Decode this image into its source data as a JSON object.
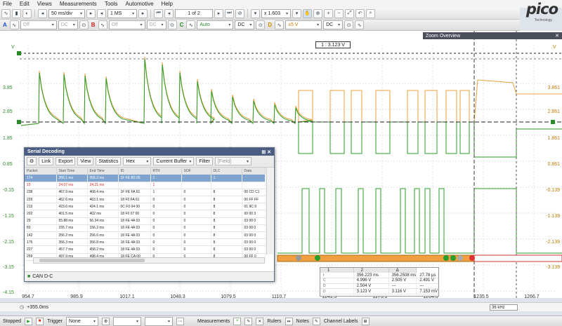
{
  "menu": [
    "File",
    "Edit",
    "Views",
    "Measurements",
    "Tools",
    "Automotive",
    "Help"
  ],
  "logo": "pico",
  "logo_sub": "Technology",
  "toolbar": {
    "timebase": "50 ms/div",
    "samples": "1 MS",
    "buffer": "1 of 2",
    "zoom": "x 1.603"
  },
  "channels": [
    {
      "letter": "A",
      "range": "Off",
      "coupling": "DC",
      "state": "off"
    },
    {
      "letter": "B",
      "range": "Off",
      "coupling": "DC",
      "state": "off"
    },
    {
      "letter": "C",
      "range": "Auto",
      "coupling": "DC",
      "state": "on"
    },
    {
      "letter": "D",
      "range": "±5 V",
      "coupling": "DC",
      "state": "on"
    }
  ],
  "plot": {
    "y_left": [
      "3.85",
      "2.85",
      "1.85",
      "0.85",
      "-0.15",
      "-1.15",
      "-2.15",
      "-3.15",
      "-4.15"
    ],
    "y_right": [
      "3.861",
      "2.861",
      "1.861",
      "0.861",
      "-0.139",
      "-1.139",
      "-2.139",
      "-3.139"
    ],
    "x_ticks": [
      "954.7",
      "985.9",
      "1017.1",
      "1048.3",
      "1079.5",
      "1110.7",
      "1141.9",
      "1173.1",
      "1204.3",
      "1235.5",
      "1266.7"
    ],
    "ruler_value": "1 : 3.123 V",
    "ruler_marker": "1",
    "top_marker": "V"
  },
  "zoom_overview": {
    "title": "Zoom Overview"
  },
  "serial_decoding": {
    "title": "Serial Decoding",
    "tools": {
      "link": "Link",
      "export": "Export",
      "view": "View",
      "statistics": "Statistics",
      "format": "Hex",
      "buffer": "Current Buffer",
      "filter": "Filter",
      "field": "[Field]"
    },
    "columns": [
      "Packet",
      "Start Time",
      "End Time",
      "ID",
      "RTR",
      "SOF",
      "DLC",
      "Data"
    ],
    "rows": [
      [
        "174",
        "356.1 ms",
        "356.2 ms",
        "1F FE B3 05",
        "1",
        "",
        "1",
        ""
      ],
      [
        "15",
        "24.07 ms",
        "24.21 ms",
        "",
        "1",
        "",
        "",
        ""
      ],
      [
        "238",
        "467.9 ms",
        "468.4 ms",
        "1F FE FA 61",
        "1",
        "0",
        "8",
        "00 CD C1"
      ],
      [
        "229",
        "462.6 ms",
        "463.1 ms",
        "18 F0 FA 61",
        "0",
        "0",
        "8",
        "00 FF FF"
      ],
      [
        "213",
        "423.6 ms",
        "424.1 ms",
        "0C F0 04 00",
        "0",
        "0",
        "8",
        "01 9C 9"
      ],
      [
        "202",
        "401.5 ms",
        "402 ms",
        "18 F0 07 00",
        "0",
        "0",
        "8",
        "00 00 3"
      ],
      [
        "29",
        "55.88 ms",
        "56.34 ms",
        "18 FE 4A 03",
        "0",
        "0",
        "8",
        "03 00 0"
      ],
      [
        "83",
        "155.7 ms",
        "156.2 ms",
        "18 FE 4A 03",
        "0",
        "0",
        "8",
        "03 00 0"
      ],
      [
        "142",
        "256.2 ms",
        "256.6 ms",
        "18 FE 4A 03",
        "0",
        "0",
        "8",
        "03 00 0"
      ],
      [
        "175",
        "356.3 ms",
        "356.8 ms",
        "18 FE 4A 03",
        "0",
        "0",
        "8",
        "03 00 0"
      ],
      [
        "227",
        "457.7 ms",
        "458.2 ms",
        "18 FE 4A 03",
        "0",
        "0",
        "8",
        "03 00 0"
      ],
      [
        "259",
        "497.9 ms",
        "498.4 ms",
        "18 FE CA 00",
        "0",
        "0",
        "8",
        "00 FF 0"
      ]
    ],
    "footer": "CAN D-C"
  },
  "cursor_table": {
    "columns": [
      "1",
      "2",
      "Δ"
    ],
    "rows": [
      {
        "icon": "t",
        "c1": "356.223 ms",
        "c2": "356.2508 ms",
        "delta": "27.78 µs"
      },
      {
        "icon": "C",
        "c1": "4.996 V",
        "c2": "2.505 V",
        "delta": "2.491 V"
      },
      {
        "icon": "D",
        "c1": "2.504 V",
        "c2": "---",
        "delta": "---"
      },
      {
        "icon": "D",
        "c1": "3.123 V",
        "c2": "3.116 V",
        "delta": "7.153 mV"
      }
    ]
  },
  "timebar": {
    "offset": "+355.0ms",
    "freq": "36 kHz"
  },
  "status": {
    "state": "Stopped",
    "trigger_label": "Trigger",
    "trigger_mode": "None",
    "measurements": "Measurements",
    "rulers": "Rulers",
    "notes": "Notes",
    "channel_labels": "Channel Labels"
  },
  "colors": {
    "channel_c": "#2a9d2a",
    "channel_d": "#e8a13a",
    "accent": "#4a5c82",
    "zoom_header": "#4a4f5a"
  }
}
